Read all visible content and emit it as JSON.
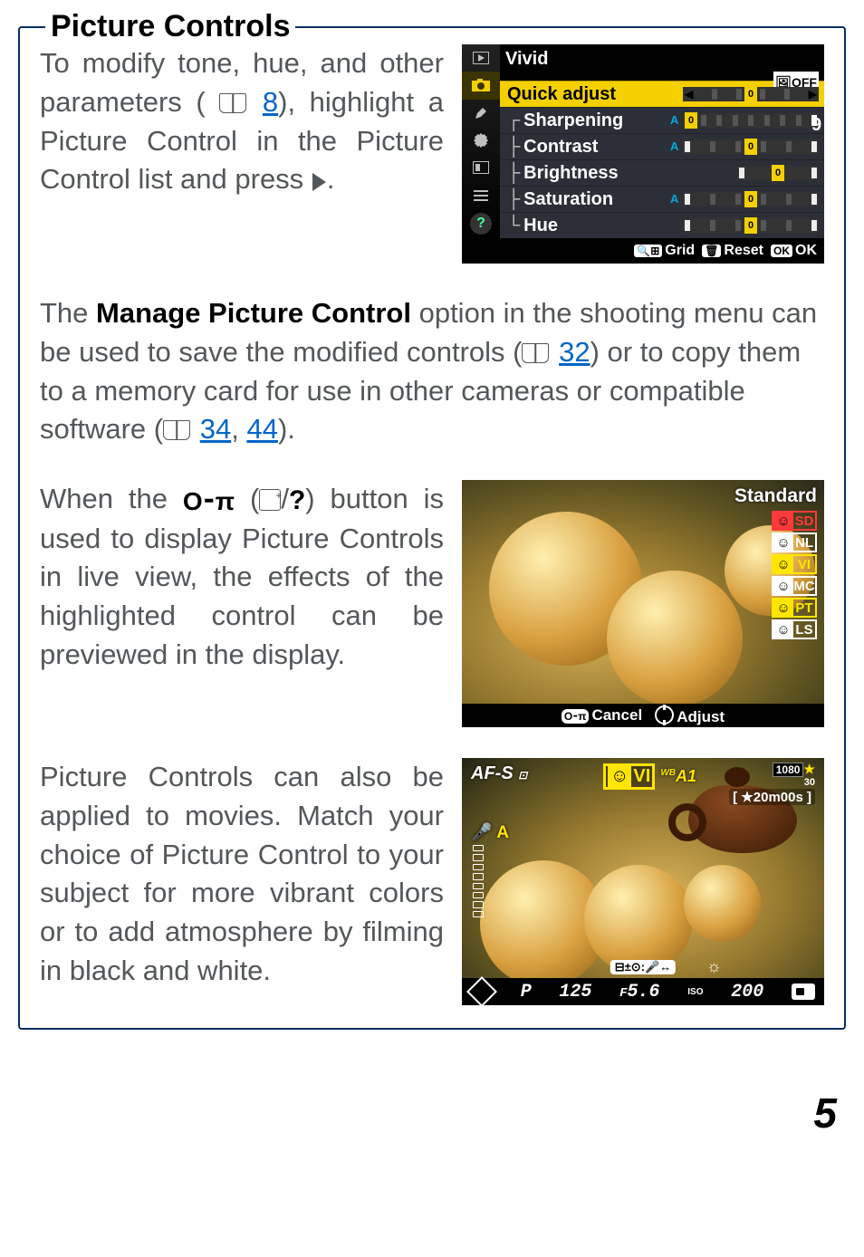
{
  "section_title": "Picture Controls",
  "para1": {
    "t1": "To modify tone, hue, and other parameters (",
    "link": "8",
    "t2": "), highlight a Picture Control in the Picture Control list and press ",
    "t3": "."
  },
  "menu": {
    "title": "Vivid",
    "eeoff": "🖼OFF",
    "items": [
      {
        "label": "Quick adjust",
        "selected": true
      },
      {
        "label": "Sharpening"
      },
      {
        "label": "Contrast"
      },
      {
        "label": "Brightness"
      },
      {
        "label": "Saturation"
      },
      {
        "label": "Hue"
      }
    ],
    "footer": {
      "grid": "Grid",
      "reset": "Reset",
      "ok": "OK"
    }
  },
  "para2": {
    "t1": "The ",
    "bold": "Manage Picture Control",
    "t2": " option in the shooting menu can be used to save the modified controls (",
    "link1": "32",
    "t3": ") or to copy them to a memory card for use in other cameras or compatible software (",
    "link2": "34",
    "t4": ", ",
    "link3": "44",
    "t5": ")."
  },
  "para3": {
    "t1": "When the ",
    "t2": " (",
    "t3": "/",
    "t4": ") button is used to display Picture Controls in live view, the effects of the highlighted control can be previewed in the display."
  },
  "preview": {
    "label": "Standard",
    "badges": [
      "SD",
      "NL",
      "VI",
      "MC",
      "PT",
      "LS"
    ],
    "cancel": "Cancel",
    "adjust": "Adjust"
  },
  "para4": "Picture Controls can also be applied to movies.  Match your choice of Picture Control to your subject for more vibrant colors or to add atmosphere by filming in black and white.",
  "movie": {
    "af": "AF-S",
    "vi": "VI",
    "wb": "A1",
    "hd": "1080",
    "fps": "30",
    "rectime": "20m00s",
    "micA": "A",
    "mode": "P",
    "shutter": "125",
    "ap_prefix": "F",
    "aperture": "5.6",
    "iso_label": "ISO",
    "iso": "200"
  },
  "page_number": "5"
}
